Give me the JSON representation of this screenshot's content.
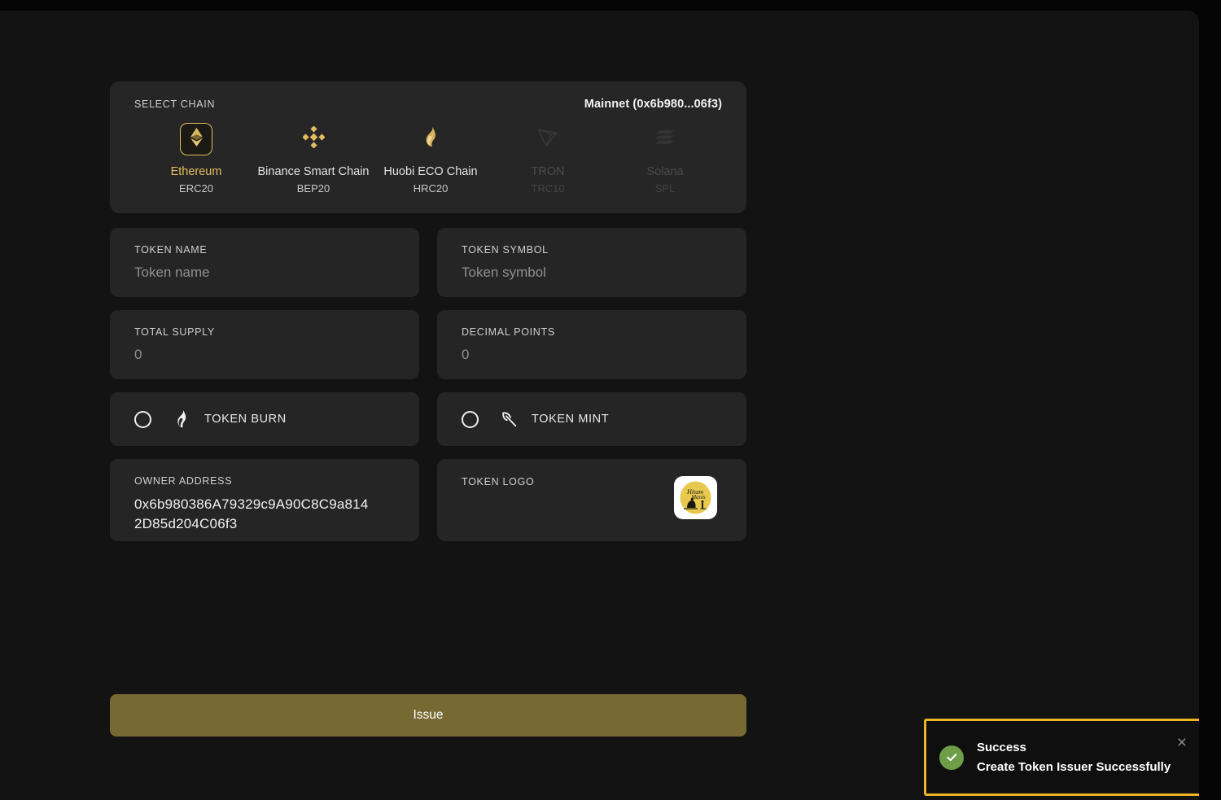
{
  "chain_section": {
    "label": "SELECT CHAIN",
    "network": "Mainnet  (0x6b980...06f3)",
    "chains": [
      {
        "name": "Ethereum",
        "standard": "ERC20",
        "icon": "ethereum-icon",
        "state": "active"
      },
      {
        "name": "Binance Smart Chain",
        "standard": "BEP20",
        "icon": "binance-icon",
        "state": "enabled"
      },
      {
        "name": "Huobi ECO Chain",
        "standard": "HRC20",
        "icon": "flame-icon",
        "state": "enabled"
      },
      {
        "name": "TRON",
        "standard": "TRC10",
        "icon": "tron-icon",
        "state": "disabled"
      },
      {
        "name": "Solana",
        "standard": "SPL",
        "icon": "solana-icon",
        "state": "disabled"
      }
    ]
  },
  "fields": {
    "token_name": {
      "label": "TOKEN NAME",
      "placeholder": "Token name"
    },
    "token_symbol": {
      "label": "TOKEN SYMBOL",
      "placeholder": "Token symbol"
    },
    "total_supply": {
      "label": "TOTAL SUPPLY",
      "placeholder": "0"
    },
    "decimal_points": {
      "label": "DECIMAL POINTS",
      "placeholder": "0"
    }
  },
  "toggles": {
    "burn": {
      "label": "TOKEN BURN",
      "icon": "flame-icon",
      "checked": false
    },
    "mint": {
      "label": "TOKEN MINT",
      "icon": "pickaxe-icon",
      "checked": false
    }
  },
  "owner": {
    "label": "OWNER ADDRESS",
    "address": "0x6b980386A79329c9A90C8C9a8142D85d204C06f3"
  },
  "logo": {
    "label": "TOKEN LOGO",
    "remove_glyph": "✕"
  },
  "submit": {
    "label": "Issue"
  },
  "toast": {
    "title": "Success",
    "message": "Create Token Issuer Successfully",
    "close_glyph": "×",
    "check_glyph": "✓"
  },
  "colors": {
    "accent_gold": "#e3bf5e",
    "toast_border": "#f0b323",
    "success_green": "#6f9e48",
    "button_bg": "#766a32",
    "page_bg": "#131313",
    "card_bg": "#262626",
    "field_bg": "#252525"
  }
}
